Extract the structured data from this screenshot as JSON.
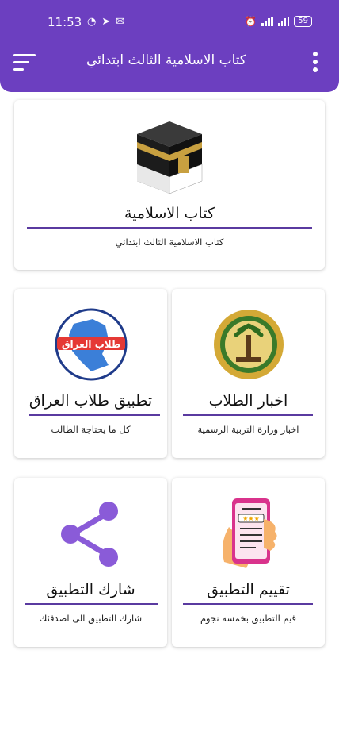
{
  "status_bar": {
    "time": "11:53",
    "battery": "59",
    "left_icons": [
      "whatsapp-icon",
      "telegram-icon",
      "mail-icon"
    ],
    "right_icons": [
      "alarm-icon",
      "signal-icon",
      "signal-icon",
      "battery-icon"
    ]
  },
  "app_bar": {
    "title": "كتاب الاسلامية الثالث ابتدائي",
    "color": "#6c3fc0",
    "menu_icon": "menu-icon",
    "overflow_icon": "more-vert-icon"
  },
  "cards": {
    "book": {
      "title": "كتاب الاسلامية",
      "subtitle": "كتاب الاسلامية الثالث ابتدائي",
      "icon": "kaaba-icon"
    },
    "iraq_students": {
      "title": "تطبيق طلاب العراق",
      "subtitle": "كل ما يحتاجة الطالب",
      "icon": "iraq-map-icon",
      "badge_text": "طلاب العراق"
    },
    "news": {
      "title": "اخبار الطلاب",
      "subtitle": "اخبار وزارة التربية الرسمية",
      "icon": "ministry-seal-icon"
    },
    "share": {
      "title": "شارك التطبيق",
      "subtitle": "شارك التطبيق الى اصدقئك",
      "icon": "share-icon"
    },
    "rate": {
      "title": "تقييم التطبيق",
      "subtitle": "قيم التطبيق بخمسة نجوم",
      "icon": "rate-phone-icon"
    }
  },
  "colors": {
    "accent": "#6c3fc0",
    "divider": "#5a3aa0",
    "share_purple": "#8a5bd8"
  }
}
